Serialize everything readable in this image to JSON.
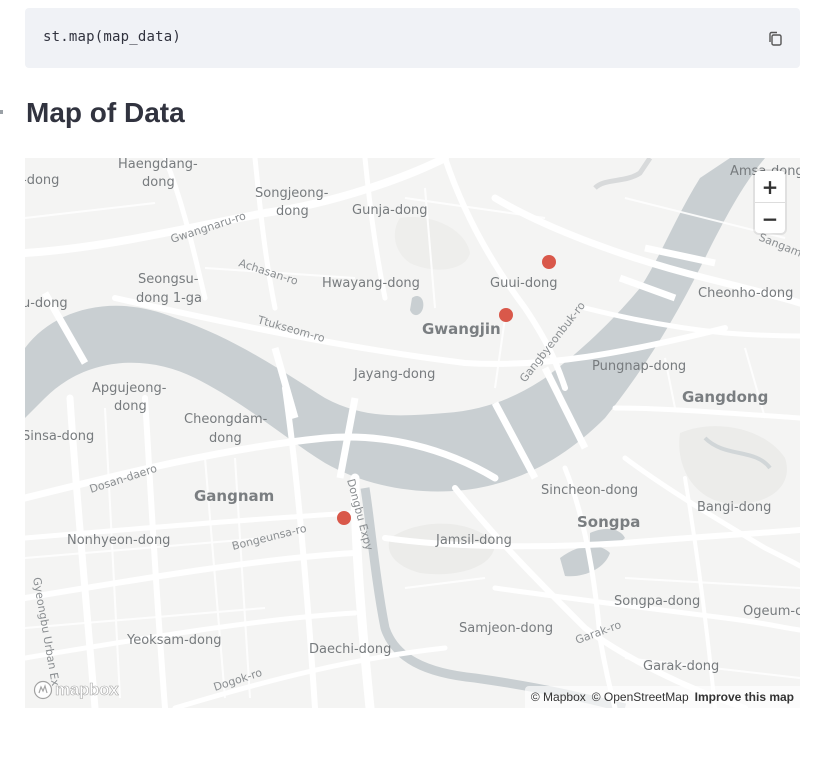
{
  "code": {
    "text": "st.map(map_data)",
    "copy_icon": "copy-icon"
  },
  "header": {
    "title": "Map of Data",
    "anchor_icon": "link-icon"
  },
  "map": {
    "labels": {
      "neighborhoods": [
        "Haengdang-",
        "dong",
        "Songjeong-",
        "dong",
        "Gunja-dong",
        "Amsa-dong",
        "-dong",
        "Seongsu-",
        "dong 1-ga",
        "Hwayang-dong",
        "Guui-dong",
        "Cheonho-dong",
        "u-dong",
        "Apgujeong-",
        "dong",
        "Jayang-dong",
        "Pungnap-dong",
        "Cheongdam-",
        "dong",
        "Sinsa-dong",
        "Sincheon-dong",
        "Bangi-dong",
        "Nonhyeon-dong",
        "Jamsil-dong",
        "Songpa-dong",
        "Ogeum-c",
        "Yeoksam-dong",
        "Samjeon-dong",
        "Daechi-dong",
        "Garak-dong",
        "Sangam"
      ],
      "districts": [
        "Gwangjin",
        "Gangdong",
        "Gangnam",
        "Songpa"
      ],
      "roads": [
        "Gwangnaru-ro",
        "Achasan-ro",
        "Ttukseom-ro",
        "Gangbyeonbuk-ro",
        "Dosan-daero",
        "Bongeunsa-ro",
        "Dongbu Expy",
        "Gyeongbu Urban Ex",
        "Garak-ro",
        "Dogok-ro"
      ]
    },
    "points_count_shown": 3,
    "zoom_in_label": "+",
    "zoom_out_label": "−",
    "logo_text": "mapbox",
    "attribution": {
      "mapbox": "© Mapbox",
      "osm": "© OpenStreetMap",
      "improve": "Improve this map"
    },
    "colors": {
      "water": "#c9cfd2",
      "land": "#f4f4f3",
      "road": "#ffffff",
      "point": "#d9584a"
    }
  }
}
